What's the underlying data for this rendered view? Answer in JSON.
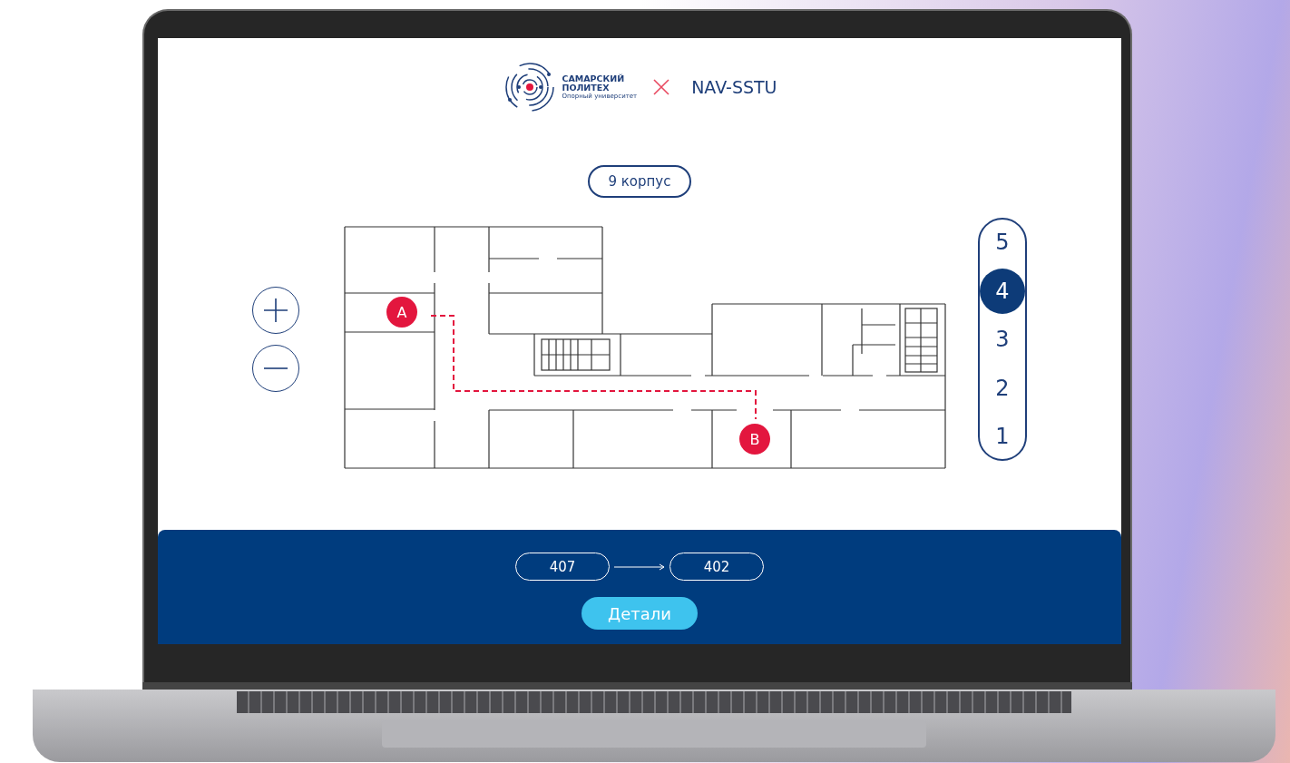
{
  "header": {
    "logo_title_lines": [
      "САМАРСКИЙ",
      "ПОЛИТЕХ"
    ],
    "logo_subtitle": "Опорный университет",
    "app_name": "NAV-SSTU"
  },
  "building": {
    "label": "9 корпус"
  },
  "map": {
    "markers": [
      {
        "label": "A"
      },
      {
        "label": "B"
      }
    ]
  },
  "floors": [
    {
      "label": "5",
      "selected": false
    },
    {
      "label": "4",
      "selected": true
    },
    {
      "label": "3",
      "selected": false
    },
    {
      "label": "2",
      "selected": false
    },
    {
      "label": "1",
      "selected": false
    }
  ],
  "route": {
    "from": "407",
    "to": "402"
  },
  "details_button": "Детали"
}
